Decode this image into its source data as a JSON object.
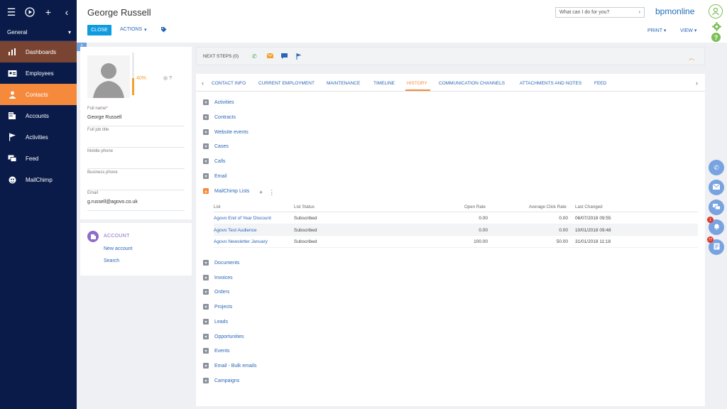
{
  "sidebar": {
    "workspace": "General",
    "items": [
      {
        "label": "Dashboards",
        "icon": "bar-chart-icon"
      },
      {
        "label": "Employees",
        "icon": "id-card-icon"
      },
      {
        "label": "Contacts",
        "icon": "person-icon"
      },
      {
        "label": "Accounts",
        "icon": "building-icon"
      },
      {
        "label": "Activities",
        "icon": "flag-icon"
      },
      {
        "label": "Feed",
        "icon": "chat-icon"
      },
      {
        "label": "MailChimp",
        "icon": "mailchimp-icon"
      }
    ]
  },
  "header": {
    "title": "George Russell",
    "close_label": "CLOSE",
    "actions_label": "ACTIONS",
    "search_placeholder": "What can I do for you?",
    "logo": "bpmonline",
    "print_label": "PRINT",
    "view_label": "VIEW"
  },
  "profile": {
    "completeness": "40%",
    "completeness_value": 40,
    "help": "?",
    "fields": [
      {
        "label": "Full name",
        "required": "*",
        "value": "George Russell"
      },
      {
        "label": "Full job title",
        "value": ""
      },
      {
        "label": "Mobile phone",
        "value": ""
      },
      {
        "label": "Business phone",
        "value": ""
      },
      {
        "label": "Email",
        "value": "g.russell@agovo.co.uk"
      }
    ]
  },
  "account": {
    "title": "ACCOUNT",
    "new_link": "New account",
    "search_link": "Search"
  },
  "next_steps": {
    "label": "NEXT STEPS (0)"
  },
  "tabs": [
    "CONTACT INFO",
    "CURRENT EMPLOYMENT",
    "MAINTENANCE",
    "TIMELINE",
    "HISTORY",
    "COMMUNICATION CHANNELS",
    "ATTACHMENTS AND NOTES",
    "FEED"
  ],
  "groups_top": [
    "Activities",
    "Contracts",
    "Website events",
    "Cases",
    "Calls",
    "Email"
  ],
  "mailchimp": {
    "label": "MailChimp Lists",
    "add": "+",
    "menu": "⋮",
    "columns": [
      "List",
      "List Status",
      "Open Rate",
      "Average Click Rate",
      "Last Changed"
    ],
    "rows": [
      {
        "list": "Agovo End of Year Discount",
        "status": "Subscribed",
        "open": "0.00",
        "click": "0.00",
        "changed": "06/07/2018 09:55"
      },
      {
        "list": "Agovo Test Audience",
        "status": "Subscribed",
        "open": "0.00",
        "click": "0.00",
        "changed": "10/01/2018 09:48"
      },
      {
        "list": "Agovo Newsletter January",
        "status": "Subscribed",
        "open": "100.00",
        "click": "50.00",
        "changed": "31/01/2018 11:18"
      }
    ]
  },
  "groups_bottom": [
    "Documents",
    "Invoices",
    "Orders",
    "Projects",
    "Leads",
    "Opportunities",
    "Events",
    "Email - Bulk emails",
    "Campaigns"
  ],
  "rail": {
    "notifications_badge": "1",
    "tasks_badge": "77"
  }
}
